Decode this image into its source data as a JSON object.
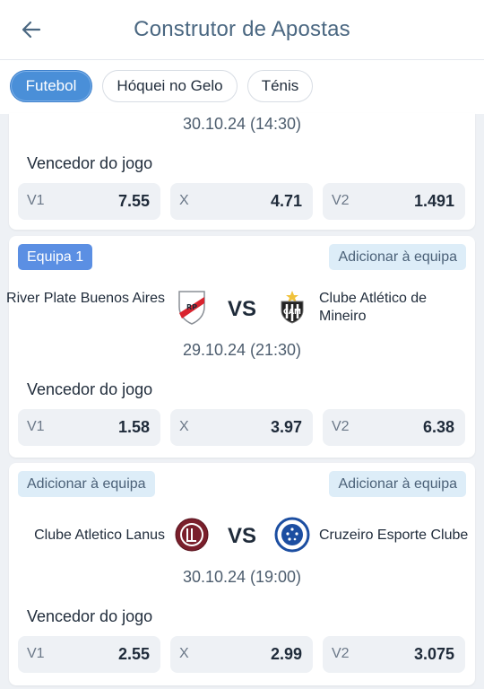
{
  "header": {
    "title": "Construtor de Apostas"
  },
  "tabs": [
    {
      "label": "Futebol",
      "active": true
    },
    {
      "label": "Hóquei no Gelo"
    },
    {
      "label": "Ténis"
    }
  ],
  "events": [
    {
      "date": "30.10.24 (14:30)",
      "market": "Vencedor do jogo",
      "odds": [
        {
          "label": "V1",
          "value": "7.55"
        },
        {
          "label": "X",
          "value": "4.71"
        },
        {
          "label": "V2",
          "value": "1.491"
        }
      ]
    },
    {
      "badge": "Equipa 1",
      "add_right": "Adicionar à equipa",
      "home": "River Plate Buenos Aires",
      "away": "Clube Atlético de Mineiro",
      "vs": "VS",
      "date": "29.10.24 (21:30)",
      "market": "Vencedor do jogo",
      "odds": [
        {
          "label": "V1",
          "value": "1.58"
        },
        {
          "label": "X",
          "value": "3.97"
        },
        {
          "label": "V2",
          "value": "6.38"
        }
      ]
    },
    {
      "add_left": "Adicionar à equipa",
      "add_right": "Adicionar à equipa",
      "home": "Clube Atletico Lanus",
      "away": "Cruzeiro Esporte Clube",
      "vs": "VS",
      "date": "30.10.24 (19:00)",
      "market": "Vencedor do jogo",
      "odds": [
        {
          "label": "V1",
          "value": "2.55"
        },
        {
          "label": "X",
          "value": "2.99"
        },
        {
          "label": "V2",
          "value": "3.075"
        }
      ]
    }
  ],
  "colors": {
    "accent": "#4a8fd8",
    "badge": "#5b8fe3",
    "add_bg": "#ddedf8",
    "odds_bg": "#eef1f5"
  },
  "icons": [
    "back-arrow-icon",
    "river-plate-logo",
    "atletico-mineiro-logo",
    "lanus-logo",
    "cruzeiro-logo"
  ]
}
